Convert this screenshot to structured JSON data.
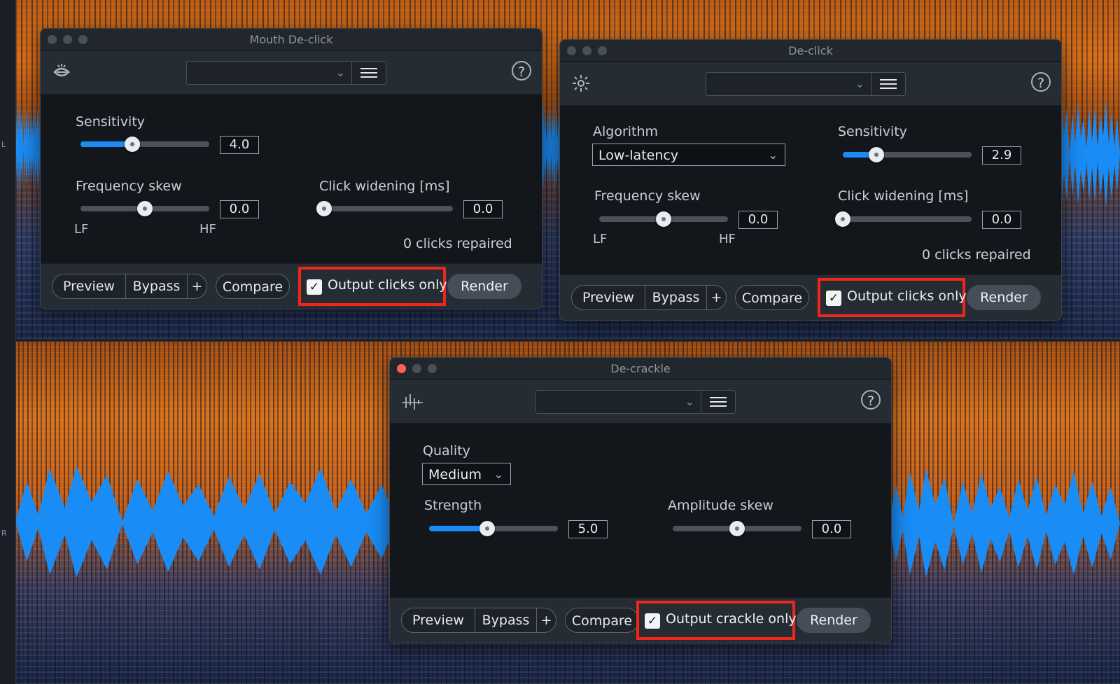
{
  "background": {
    "channel_left_label": "L",
    "channel_right_label": "R",
    "colors": {
      "spectrogram_orange": "#d86c16",
      "waveform_blue": "#1a8cf5"
    }
  },
  "windows": {
    "mouth_declick": {
      "title": "Mouth De-click",
      "logo_icon": "mouth-icon",
      "preset_value": "",
      "sensitivity": {
        "label": "Sensitivity",
        "value": "4.0",
        "fraction": 0.4
      },
      "frequency_skew": {
        "label": "Frequency skew",
        "value": "0.0",
        "fraction": 0.5,
        "min_label": "LF",
        "max_label": "HF"
      },
      "click_widening": {
        "label": "Click widening [ms]",
        "value": "0.0",
        "fraction": 0.0
      },
      "status": "0 clicks repaired",
      "footer": {
        "preview": "Preview",
        "bypass": "Bypass",
        "plus": "+",
        "compare": "Compare",
        "output_label": "Output clicks only",
        "output_checked": true,
        "render": "Render"
      }
    },
    "declick": {
      "title": "De-click",
      "logo_icon": "sparkle-icon",
      "preset_value": "",
      "algorithm": {
        "label": "Algorithm",
        "value": "Low-latency"
      },
      "sensitivity": {
        "label": "Sensitivity",
        "value": "2.9",
        "fraction": 0.26
      },
      "frequency_skew": {
        "label": "Frequency skew",
        "value": "0.0",
        "fraction": 0.5,
        "min_label": "LF",
        "max_label": "HF"
      },
      "click_widening": {
        "label": "Click widening [ms]",
        "value": "0.0",
        "fraction": 0.0
      },
      "status": "0 clicks repaired",
      "footer": {
        "preview": "Preview",
        "bypass": "Bypass",
        "plus": "+",
        "compare": "Compare",
        "output_label": "Output clicks only",
        "output_checked": true,
        "render": "Render"
      }
    },
    "decrackle": {
      "title": "De-crackle",
      "logo_icon": "crackle-icon",
      "preset_value": "",
      "quality": {
        "label": "Quality",
        "value": "Medium"
      },
      "strength": {
        "label": "Strength",
        "value": "5.0",
        "fraction": 0.45
      },
      "amplitude_skew": {
        "label": "Amplitude skew",
        "value": "0.0",
        "fraction": 0.5
      },
      "footer": {
        "preview": "Preview",
        "bypass": "Bypass",
        "plus": "+",
        "compare": "Compare",
        "output_label": "Output crackle only",
        "output_checked": true,
        "render": "Render"
      }
    }
  },
  "highlight_color": "#f0261b"
}
